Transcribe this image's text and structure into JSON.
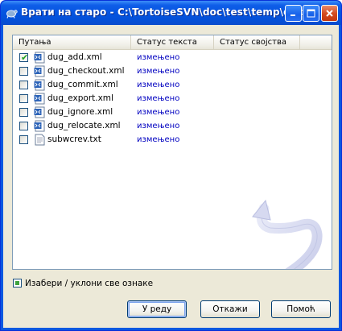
{
  "window": {
    "title": "Врати на старо - C:\\TortoiseSVN\\doc\\test\\temp\\doc"
  },
  "list": {
    "columns": [
      "Путања",
      "Статус текста",
      "Статус својства"
    ],
    "rows": [
      {
        "name": "dug_add.xml",
        "status": "измењено",
        "checked": true,
        "icon": "xml-file-icon"
      },
      {
        "name": "dug_checkout.xml",
        "status": "измењено",
        "checked": false,
        "icon": "xml-file-icon"
      },
      {
        "name": "dug_commit.xml",
        "status": "измењено",
        "checked": false,
        "icon": "xml-file-icon"
      },
      {
        "name": "dug_export.xml",
        "status": "измењено",
        "checked": false,
        "icon": "xml-file-icon"
      },
      {
        "name": "dug_ignore.xml",
        "status": "измењено",
        "checked": false,
        "icon": "xml-file-icon"
      },
      {
        "name": "dug_relocate.xml",
        "status": "измењено",
        "checked": false,
        "icon": "xml-file-icon"
      },
      {
        "name": "subwcrev.txt",
        "status": "измењено",
        "checked": false,
        "icon": "text-file-icon"
      }
    ]
  },
  "select_all": {
    "label": "Изабери / уклони све ознаке"
  },
  "buttons": {
    "ok": "У реду",
    "cancel": "Откажи",
    "help": "Помоћ"
  },
  "colors": {
    "titlebar": "#0554e0",
    "client": "#ece9d8",
    "status_text": "#0000c0",
    "checkmark": "#21a121"
  }
}
